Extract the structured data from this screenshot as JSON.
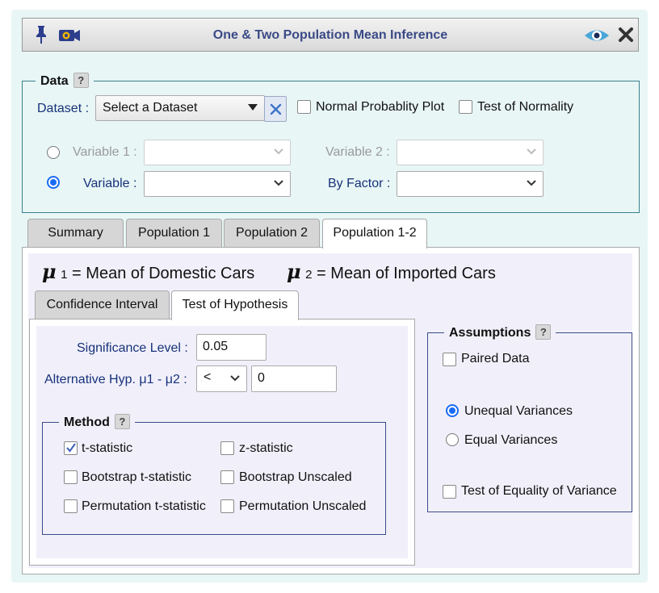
{
  "window": {
    "title": "One & Two Population Mean Inference",
    "icons": [
      "pin-icon",
      "camera-icon",
      "eye-icon",
      "close-icon"
    ]
  },
  "data_section": {
    "legend": "Data",
    "dataset_label": "Dataset :",
    "dataset_value": "Select a Dataset",
    "normal_plot_label": "Normal Probablity Plot",
    "normality_test_label": "Test of Normality",
    "variable1_label": "Variable 1 :",
    "variable2_label": "Variable 2 :",
    "variable_label": "Variable :",
    "byfactor_label": "By Factor :",
    "selected_mode": "variable"
  },
  "tabs": [
    "Summary",
    "Population 1",
    "Population 2",
    "Population 1-2"
  ],
  "active_tab": "Population 1-2",
  "population_header": {
    "mu1_symbol": "μ",
    "mu1_sub": "1",
    "mu1_text": "= Mean of Domestic Cars",
    "mu2_symbol": "μ",
    "mu2_sub": "2",
    "mu2_text": "= Mean of Imported Cars"
  },
  "subtabs": [
    "Confidence Interval",
    "Test of Hypothesis"
  ],
  "active_subtab": "Test of Hypothesis",
  "hypothesis": {
    "significance_label": "Significance Level :",
    "significance_value": "0.05",
    "alternative_label": "Alternative Hyp. μ1 - μ2 :",
    "alternative_operator": "<",
    "alternative_value": "0"
  },
  "method": {
    "legend": "Method",
    "options": [
      {
        "label": "t-statistic",
        "checked": true
      },
      {
        "label": "z-statistic",
        "checked": false
      },
      {
        "label": "Bootstrap t-statistic",
        "checked": false
      },
      {
        "label": "Bootstrap Unscaled",
        "checked": false
      },
      {
        "label": "Permutation t-statistic",
        "checked": false
      },
      {
        "label": "Permutation Unscaled",
        "checked": false
      }
    ]
  },
  "assumptions": {
    "legend": "Assumptions",
    "paired_label": "Paired Data",
    "unequal_label": "Unequal Variances",
    "equal_label": "Equal Variances",
    "selected_variance": "unequal",
    "equality_test_label": "Test of Equality of Variance"
  },
  "colors": {
    "accent": "#1a6cf5",
    "title_text": "#3a4a86",
    "label_text": "#17327a",
    "frame_bg": "#e8f6f5",
    "panel_bg": "#f1f0fa",
    "border_teal": "#3a7f8f",
    "method_border": "#3b4a8a",
    "clear_button": "#3b74c9"
  }
}
